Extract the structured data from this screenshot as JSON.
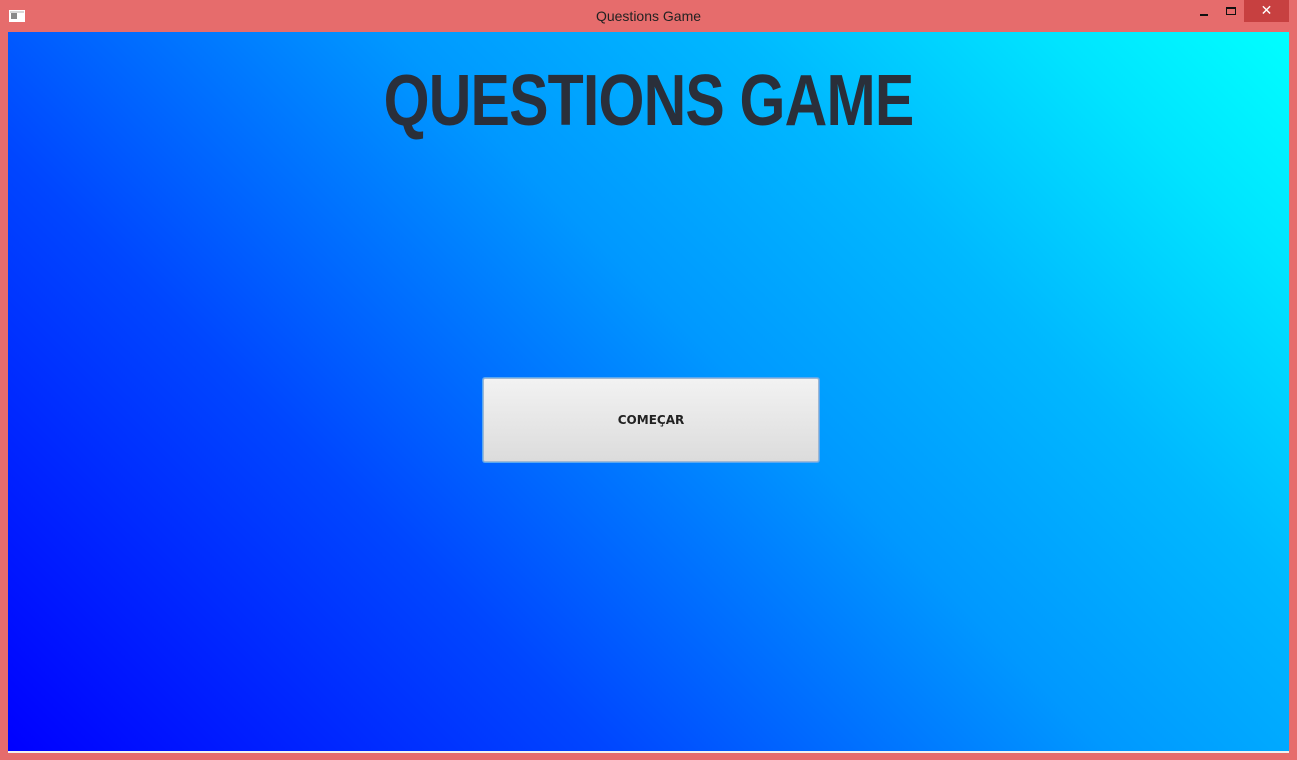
{
  "window": {
    "title": "Questions Game",
    "icon": "app-window-icon",
    "controls": {
      "minimize_icon": "minimize-icon",
      "maximize_icon": "maximize-icon",
      "close_label": "✕"
    },
    "frame_color": "#e66c6c"
  },
  "game": {
    "title": "QUESTIONS GAME",
    "start_button_label": "COMEÇAR",
    "background_colors": [
      "#0000ff",
      "#00ffff"
    ]
  }
}
